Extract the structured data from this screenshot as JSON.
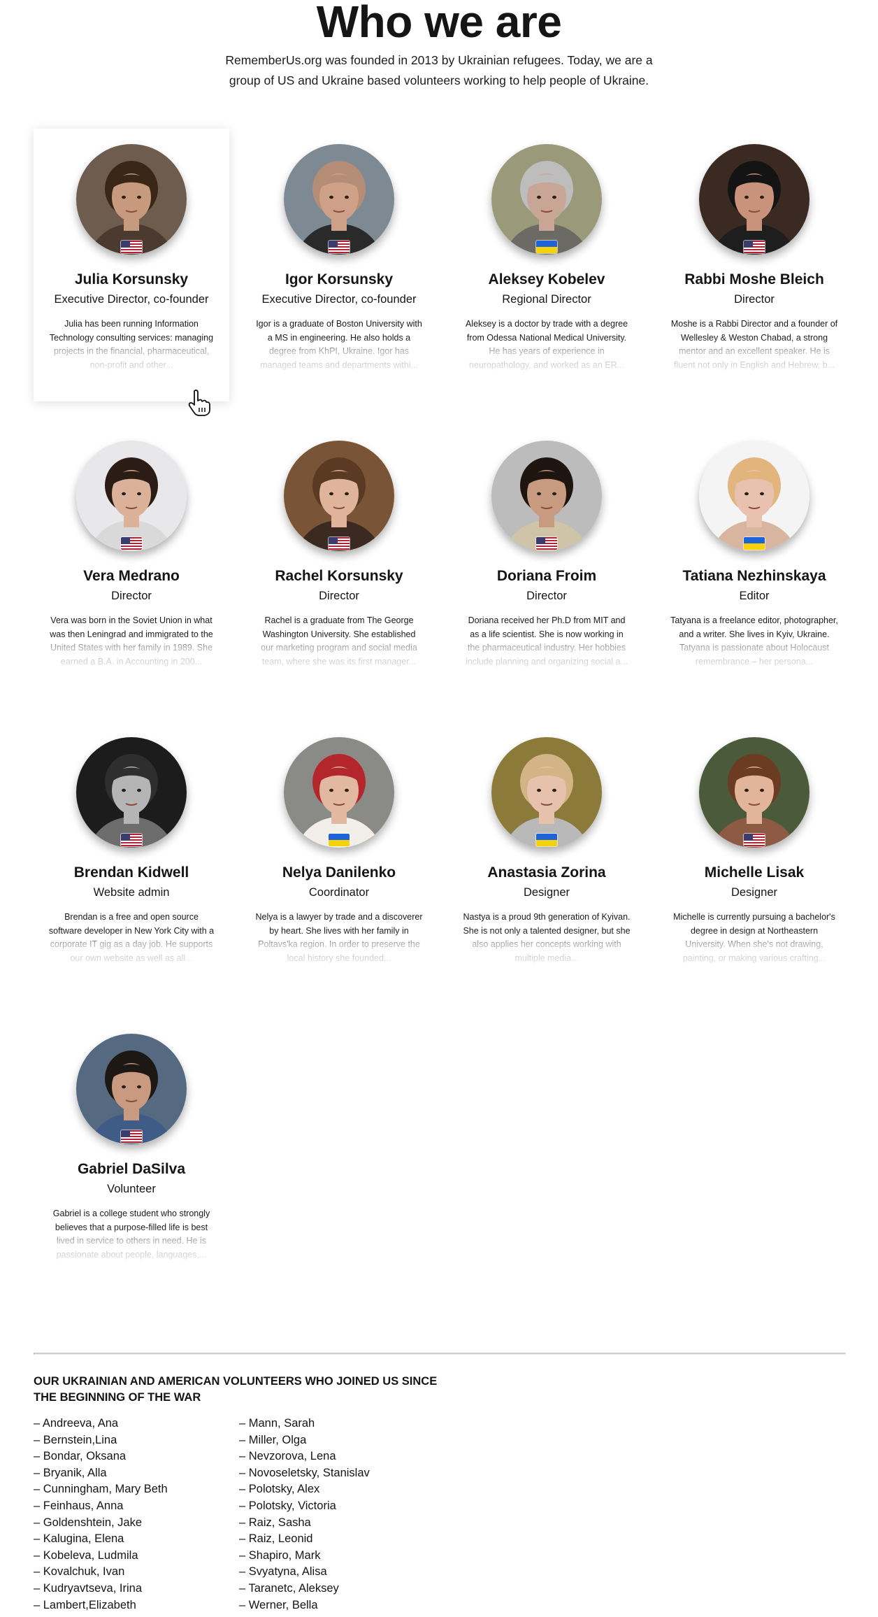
{
  "page": {
    "title": "Who we are",
    "intro": "RememberUs.org was founded in 2013 by Ukrainian refugees. Today, we are a group of US and Ukraine based volunteers working to help people of Ukraine."
  },
  "team": [
    {
      "name": "Julia Korsunsky",
      "role": "Executive Director, co-founder",
      "bio": "Julia has been running Information Technology consulting services: managing projects in the financial, pharmaceutical, non-profit and other...",
      "flag": "us-flag",
      "photo_bg": "#6e5d4e",
      "skin": "#c79a7e",
      "hair": "#3a2616",
      "shirt": "#4a3a30"
    },
    {
      "name": "Igor Korsunsky",
      "role": "Executive Director, co-founder",
      "bio": "Igor is a graduate of Boston University with a MS in engineering. He also holds a degree from KhPI, Ukraine. Igor has managed teams and departments withi...",
      "flag": "us-flag",
      "photo_bg": "#7d8a93",
      "skin": "#cfa088",
      "hair": "#b58d76",
      "shirt": "#2a2a2a"
    },
    {
      "name": "Aleksey Kobelev",
      "role": "Regional Director",
      "bio": "Aleksey is a doctor by trade with a degree from Odessa National Medical University. He has years of experience in neuropathology, and worked as an ER...",
      "flag": "ua-flag",
      "photo_bg": "#9a9a7a",
      "skin": "#c9a596",
      "hair": "#bdbdbd",
      "shirt": "#6c6a64"
    },
    {
      "name": "Rabbi Moshe Bleich",
      "role": "Director",
      "bio": "Moshe is a Rabbi Director and a founder of Wellesley & Weston Chabad, a strong mentor and an excellent speaker. He is fluent not only in English and Hebrew, b...",
      "flag": "us-flag",
      "photo_bg": "#3a2a22",
      "skin": "#c9927a",
      "hair": "#141414",
      "shirt": "#1e1e1e"
    },
    {
      "name": "Vera Medrano",
      "role": "Director",
      "bio": "Vera was born in the Soviet Union in what was then Leningrad and immigrated to the United States with her family in 1989. She earned a B.A. in Accounting in 200...",
      "flag": "us-flag",
      "photo_bg": "#e8e8ea",
      "skin": "#dcb19a",
      "hair": "#2b1d16",
      "shirt": "#d9d9d9"
    },
    {
      "name": "Rachel Korsunsky",
      "role": "Director",
      "bio": "Rachel is a graduate from The George Washington University. She established our marketing program and social media team, where she was its first manager...",
      "flag": "us-flag",
      "photo_bg": "#7a5436",
      "skin": "#e0b49a",
      "hair": "#5a3a22",
      "shirt": "#3a2a22"
    },
    {
      "name": "Doriana Froim",
      "role": "Director",
      "bio": "Doriana received her Ph.D from MIT and as a life scientist. She is now working in the pharmaceutical industry. Her hobbies include planning and organizing social a...",
      "flag": "us-flag",
      "photo_bg": "#bcbcbc",
      "skin": "#c89a80",
      "hair": "#1e1510",
      "shirt": "#cfc3a8"
    },
    {
      "name": "Tatiana Nezhinskaya",
      "role": "Editor",
      "bio": "Tatyana is a freelance editor, photographer, and a writer. She lives in Kyiv, Ukraine. Tatyana is passionate about Holocaust remembrance – her persona...",
      "flag": "ua-flag",
      "photo_bg": "#f4f4f4",
      "skin": "#e8c2ae",
      "hair": "#e3b57e",
      "shirt": "#d7b59e"
    },
    {
      "name": "Brendan Kidwell",
      "role": "Website admin",
      "bio": "Brendan is a free and open source software developer in New York City with a corporate IT gig as a day job. He supports our own website as well as all...",
      "flag": "us-flag",
      "photo_bg": "#1c1c1c",
      "skin": "#b5b5b5",
      "hair": "#2e2e2e",
      "shirt": "#6d6d6d"
    },
    {
      "name": "Nelya Danilenko",
      "role": "Coordinator",
      "bio": "Nelya is a lawyer by trade and a discoverer by heart. She lives with her family in Poltavs'ka region. In order to preserve the local history she founded...",
      "flag": "ua-flag",
      "photo_bg": "#8a8a86",
      "skin": "#e2b8a0",
      "hair": "#b3262c",
      "shirt": "#f2eeea"
    },
    {
      "name": "Anastasia Zorina",
      "role": "Designer",
      "bio": "Nastya is a proud 9th generation of Kyivan. She is not only a talented designer, but she also applies her concepts working with multiple media...",
      "flag": "ua-flag",
      "photo_bg": "#8c7a3a",
      "skin": "#e6c2ac",
      "hair": "#d3b486",
      "shirt": "#b9b9b9"
    },
    {
      "name": "Michelle Lisak",
      "role": "Designer",
      "bio": "Michelle is currently pursuing a bachelor's degree in design at Northeastern University. When she's not drawing, painting, or making various crafting...",
      "flag": "us-flag",
      "photo_bg": "#4a5a3a",
      "skin": "#e2b49a",
      "hair": "#6b3b22",
      "shirt": "#8d5a44"
    },
    {
      "name": "Gabriel DaSilva",
      "role": "Volunteer",
      "bio": "Gabriel is a college student who strongly believes that a purpose-filled life is best lived in service to others in need. He is passionate about people, languages,...",
      "flag": "us-flag",
      "photo_bg": "#556a80",
      "skin": "#c99a80",
      "hair": "#1e1814",
      "shirt": "#3f5c86"
    }
  ],
  "volunteers": {
    "heading": "OUR UKRAINIAN AND AMERICAN VOLUNTEERS WHO JOINED US SINCE THE BEGINNING OF THE WAR",
    "column1": [
      "– Andreeva, Ana",
      "– Bernstein,Lina",
      "– Bondar, Oksana",
      "– Bryanik, Alla",
      "– Cunningham, Mary Beth",
      "– Feinhaus, Anna",
      "– Goldenshtein, Jake",
      "– Kalugina, Elena",
      "– Kobeleva, Ludmila",
      "– Kovalchuk, Ivan",
      "– Kudryavtseva, Irina",
      "– Lambert,Elizabeth"
    ],
    "column2": [
      "– Mann, Sarah",
      "– Miller, Olga",
      "– Nevzorova, Lena",
      "– Novoseletsky, Stanislav",
      "– Polotsky, Alex",
      "– Polotsky, Victoria",
      "– Raiz, Sasha",
      "– Raiz, Leonid",
      "– Shapiro, Mark",
      "– Svyatyna, Alisa",
      "– Taranetc, Aleksey",
      "– Werner, Bella"
    ]
  },
  "cursor_icon": "hand-pointer-icon"
}
